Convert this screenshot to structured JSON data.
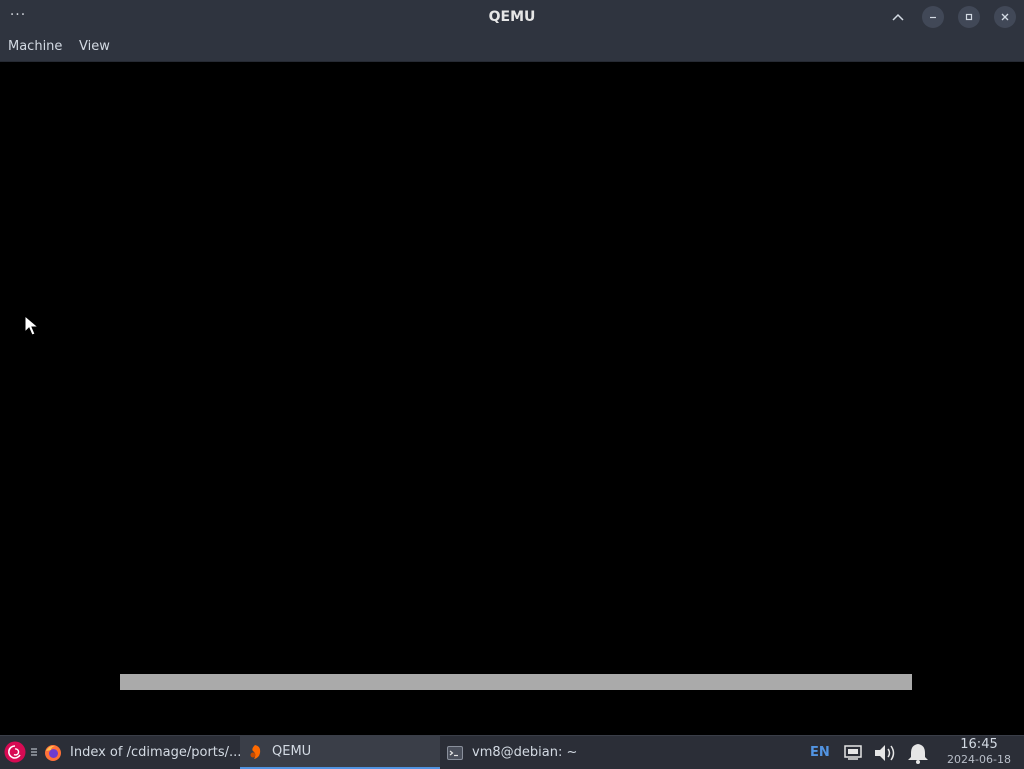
{
  "window": {
    "title": "QEMU",
    "menu": [
      "Machine",
      "View"
    ]
  },
  "vm": {
    "progress_fraction": 1.0
  },
  "taskbar": {
    "tasks": [
      {
        "label": "Index of /cdimage/ports/...",
        "icon": "firefox-icon"
      },
      {
        "label": "QEMU",
        "icon": "qemu-icon",
        "active": true
      },
      {
        "label": "vm8@debian: ~",
        "icon": "terminal-icon"
      }
    ],
    "tray": {
      "language": "EN"
    },
    "clock": {
      "time": "16:45",
      "date": "2024-06-18"
    }
  },
  "colors": {
    "accent": "#5294e2",
    "titlebar": "#2f343f",
    "taskbar": "#2b2e37",
    "progress": "#aaaaaa"
  }
}
